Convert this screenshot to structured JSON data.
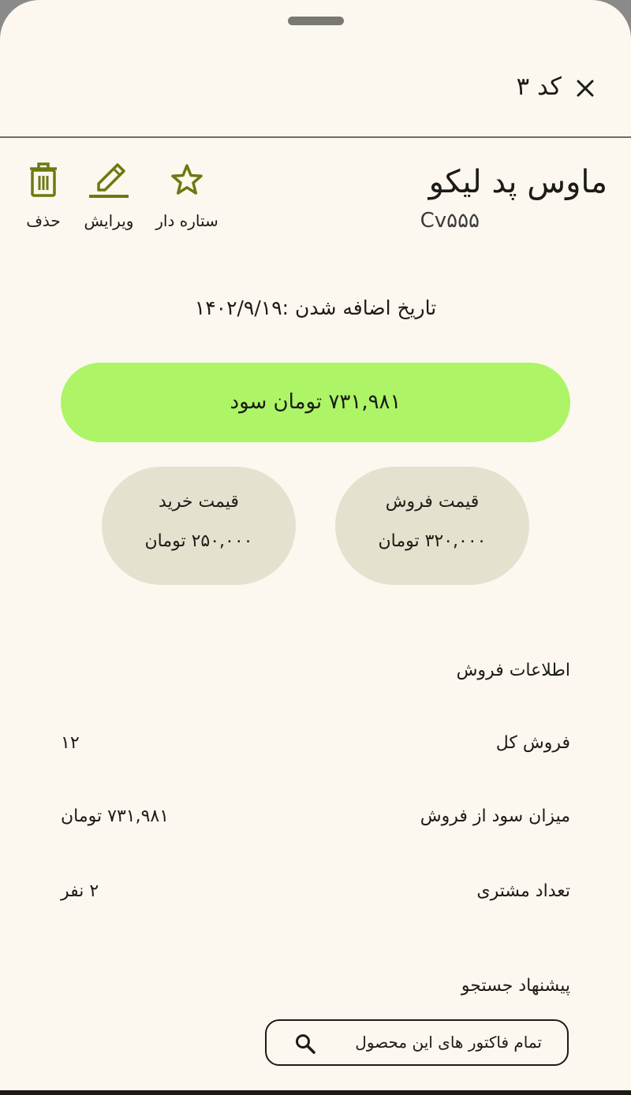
{
  "header": {
    "title": "کد ۳",
    "close_icon": "close-icon"
  },
  "product": {
    "name": "ماوس پد لیکو",
    "code": "Cv۵۵۵"
  },
  "actions": [
    {
      "label": "ستاره دار",
      "icon": "star-icon"
    },
    {
      "label": "ویرایش",
      "icon": "edit-icon"
    },
    {
      "label": "حذف",
      "icon": "trash-icon"
    }
  ],
  "date_added": "تاریخ اضافه شدن :۱۴۰۲/۹/۱۹",
  "profit": {
    "text": "۷۳۱,۹۸۱ تومان سود",
    "color": "#adf566"
  },
  "prices": {
    "sell": {
      "title": "قیمت فروش",
      "value": "۳۲۰,۰۰۰ تومان"
    },
    "buy": {
      "title": "قیمت خرید",
      "value": "۲۵۰,۰۰۰ تومان"
    }
  },
  "sales_info": {
    "title": "اطلاعات فروش",
    "rows": [
      {
        "label": "فروش کل",
        "value": "۱۲"
      },
      {
        "label": "میزان سود از فروش",
        "value": "۷۳۱,۹۸۱ تومان"
      },
      {
        "label": "تعداد مشتری",
        "value": "۲ نفر"
      }
    ]
  },
  "search_suggestion": {
    "title": "پیشنهاد جستجو",
    "button_label": "تمام فاکتور های این محصول",
    "icon": "search-icon"
  },
  "colors": {
    "accent": "#6b7a10",
    "card": "#e4e1cf",
    "background": "#fcf8f0"
  }
}
